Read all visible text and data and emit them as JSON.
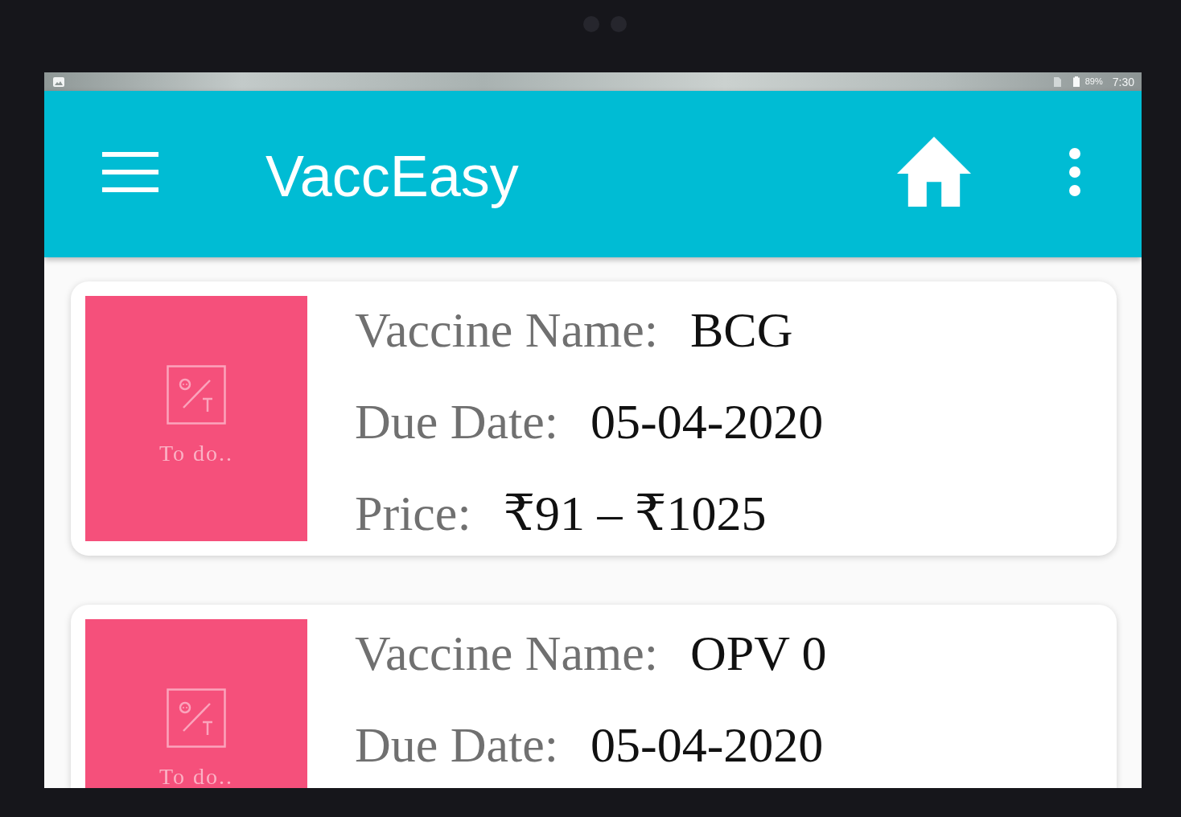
{
  "status_bar": {
    "battery": "89%",
    "time": "7:30"
  },
  "app_bar": {
    "title": "VaccEasy"
  },
  "vaccines": [
    {
      "tile_label": "To do..",
      "rows": [
        {
          "label": "Vaccine Name:",
          "value": "BCG"
        },
        {
          "label": "Due Date:",
          "value": "05-04-2020"
        },
        {
          "label": "Price:",
          "value": "₹91 – ₹1025"
        }
      ]
    },
    {
      "tile_label": "To do..",
      "rows": [
        {
          "label": "Vaccine Name:",
          "value": "OPV 0"
        },
        {
          "label": "Due Date:",
          "value": "05-04-2020"
        }
      ]
    }
  ]
}
